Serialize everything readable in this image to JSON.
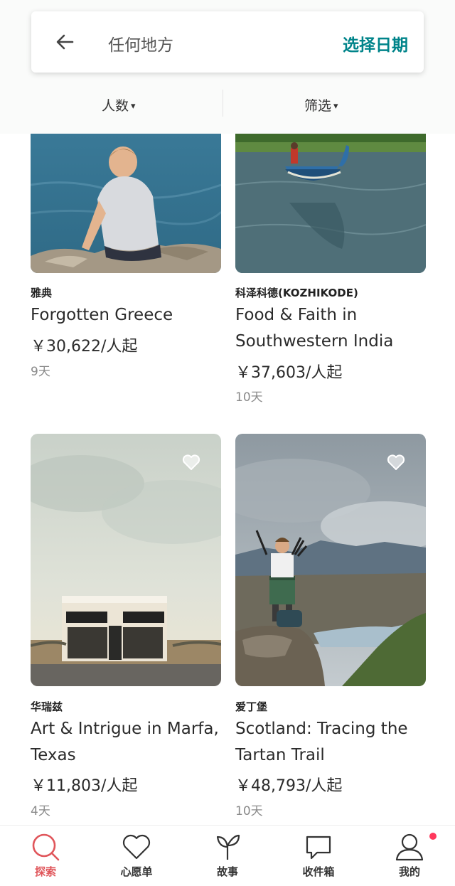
{
  "search": {
    "back_icon": "arrow-left-icon",
    "location_text": "任何地方",
    "date_button": "选择日期"
  },
  "filters": {
    "guests_label": "人数",
    "filter_label": "筛选",
    "caret": "▾"
  },
  "experiences": [
    {
      "location": "雅典",
      "title_lines": [
        "Forgotten Greece"
      ],
      "price": "￥30,622/人起",
      "duration": "9天",
      "wishlisted": false
    },
    {
      "location": "科泽科德(KOZHIKODE)",
      "title_lines": [
        "Food & Faith in",
        "Southwestern India"
      ],
      "price": "￥37,603/人起",
      "duration": "10天",
      "wishlisted": false
    },
    {
      "location": "华瑞兹",
      "title_lines": [
        "Art & Intrigue in Marfa,",
        "Texas"
      ],
      "price": "￥11,803/人起",
      "duration": "4天",
      "wishlisted": false
    },
    {
      "location": "爱丁堡",
      "title_lines": [
        "Scotland: Tracing the",
        "Tartan Trail"
      ],
      "price": "￥48,793/人起",
      "duration": "10天",
      "wishlisted": false
    }
  ],
  "nav": {
    "items": [
      {
        "label": "探索",
        "icon": "search-icon",
        "active": true
      },
      {
        "label": "心愿单",
        "icon": "heart-icon",
        "active": false
      },
      {
        "label": "故事",
        "icon": "sprout-icon",
        "active": false
      },
      {
        "label": "收件箱",
        "icon": "chat-bubble-icon",
        "active": false
      },
      {
        "label": "我的",
        "icon": "user-icon",
        "active": false
      }
    ],
    "profile_has_notification": true
  },
  "colors": {
    "accent_teal": "#00848a",
    "active_red": "#e0565b",
    "notification": "#ff385c"
  }
}
